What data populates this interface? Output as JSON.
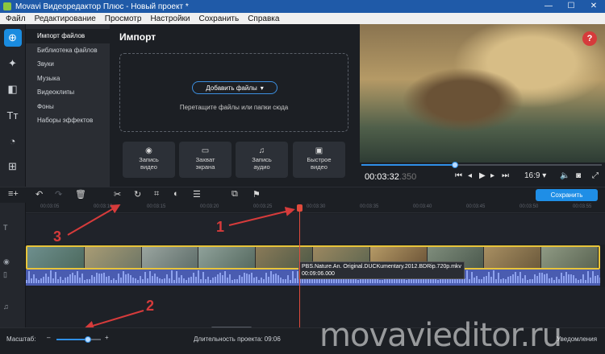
{
  "window": {
    "title": "Movavi Видеоредактор Плюс - Новый проект *",
    "controls": [
      "—",
      "☐",
      "✕"
    ]
  },
  "menu": [
    "Файл",
    "Редактирование",
    "Просмотр",
    "Настройки",
    "Сохранить",
    "Справка"
  ],
  "sidebar_icons": [
    "import-icon",
    "magic-wand-icon",
    "transitions-icon",
    "titles-icon",
    "filters-icon",
    "more-tools-icon"
  ],
  "import_menu": [
    "Импорт файлов",
    "Библиотека файлов",
    "Звуки",
    "Музыка",
    "Видеоклипы",
    "Фоны",
    "Наборы эффектов"
  ],
  "import": {
    "title": "Импорт",
    "add_files": "Добавить файлы",
    "drop_hint": "Перетащите файлы или папки сюда",
    "capture": [
      {
        "line1": "Запись",
        "line2": "видео",
        "icon": "◉"
      },
      {
        "line1": "Захват",
        "line2": "экрана",
        "icon": "▭"
      },
      {
        "line1": "Запись",
        "line2": "аудио",
        "icon": "♫"
      },
      {
        "line1": "Быстрое",
        "line2": "видео",
        "icon": "▣"
      }
    ]
  },
  "player": {
    "help": "?",
    "time_main": "00:03:32",
    "time_ms": ".350",
    "aspect": "16:9 ▾",
    "progress": 0.39
  },
  "save_button": "Сохранить",
  "ruler_ticks": [
    "00:03:05",
    "00:03:10",
    "00:03:15",
    "00:03:20",
    "00:03:25",
    "00:03:30",
    "00:03:35",
    "00:03:40",
    "00:03:45",
    "00:03:50",
    "00:03:55"
  ],
  "clip_tooltip": {
    "name": "PBS.Nature.An. Original.DUCKumentary.2012.BDRip.720p.mkv",
    "duration": "00:09:06.000"
  },
  "annotations": [
    "1",
    "2",
    "3"
  ],
  "bottom": {
    "scale_label": "Масштаб:",
    "zoom_level": 0.7,
    "duration_label": "Длительность проекта: 09:06",
    "notifications": "Уведомления"
  },
  "watermark": "movavieditor.ru"
}
